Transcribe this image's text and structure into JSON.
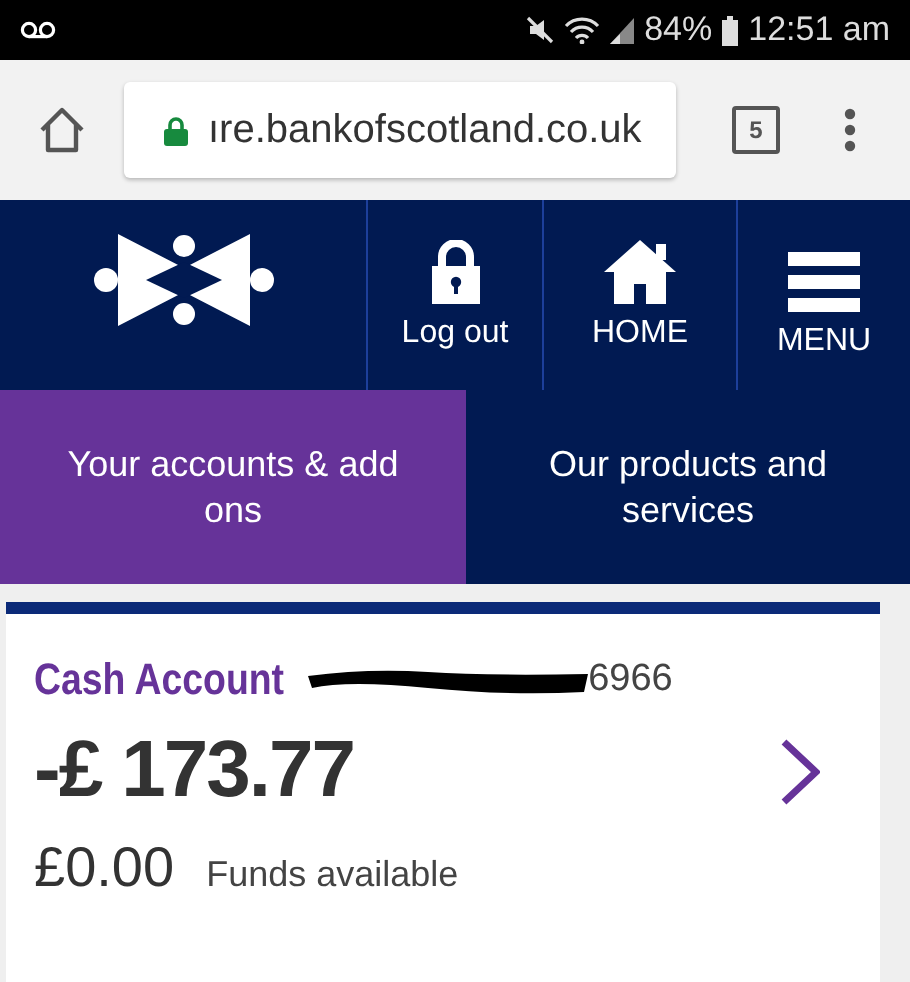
{
  "status_bar": {
    "battery": "84%",
    "time": "12:51 am"
  },
  "browser": {
    "url": "ıre.bankofscotland.co.uk",
    "tab_count": "5"
  },
  "header": {
    "nav": [
      {
        "kind": "logout",
        "label": "Log out"
      },
      {
        "kind": "home",
        "label": "HOME"
      },
      {
        "kind": "menu",
        "label": "MENU"
      }
    ]
  },
  "tabs": [
    {
      "label": "Your accounts & add ons",
      "selected": true
    },
    {
      "label": "Our products and services",
      "selected": false
    }
  ],
  "account": {
    "name": "Cash Account",
    "number_end": "6966",
    "balance": "-£ 173.77",
    "funds": "£0.00",
    "funds_label": "Funds available"
  }
}
